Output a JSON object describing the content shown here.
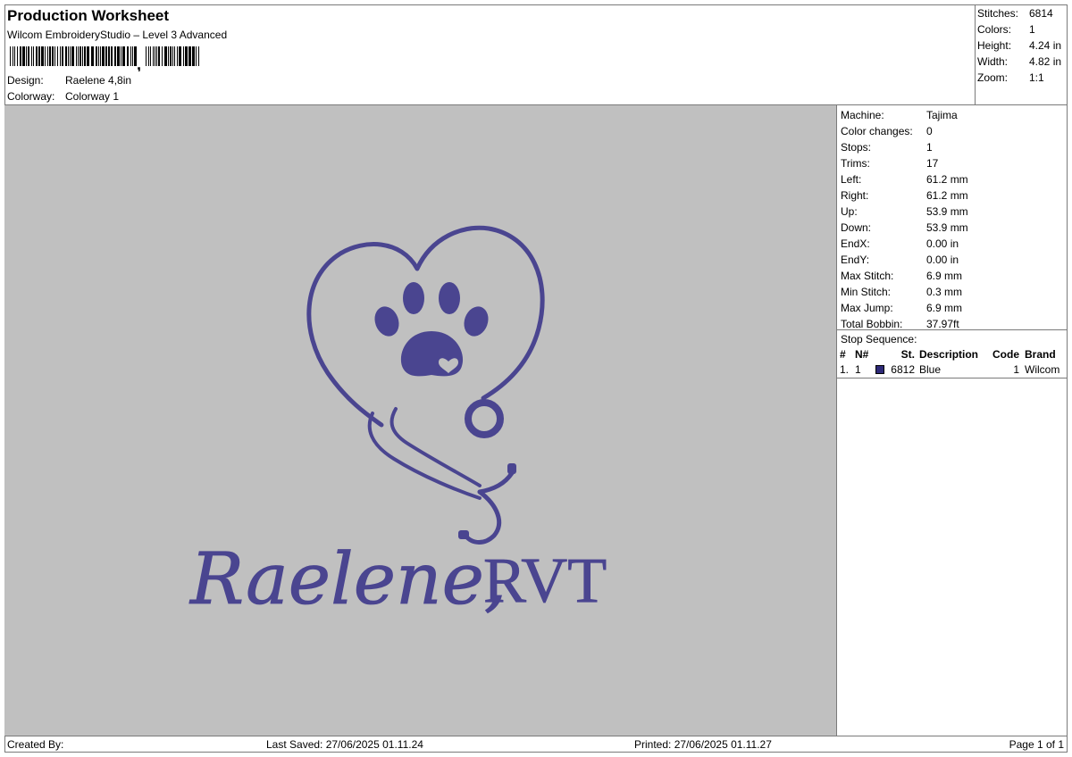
{
  "header": {
    "title": "Production Worksheet",
    "application": "Wilcom EmbroideryStudio – Level 3 Advanced",
    "design_label": "Design:",
    "design_value": "Raelene 4,8in",
    "colorway_label": "Colorway:",
    "colorway_value": "Colorway 1"
  },
  "summary": [
    {
      "label": "Stitches:",
      "value": "6814"
    },
    {
      "label": "Colors:",
      "value": "1"
    },
    {
      "label": "Height:",
      "value": "4.24 in"
    },
    {
      "label": "Width:",
      "value": "4.82 in"
    },
    {
      "label": "Zoom:",
      "value": "1:1"
    }
  ],
  "machine_info": [
    {
      "label": "Machine:",
      "value": "Tajima"
    },
    {
      "label": "Color changes:",
      "value": "0"
    },
    {
      "label": "Stops:",
      "value": "1"
    },
    {
      "label": "Trims:",
      "value": "17"
    },
    {
      "label": "Left:",
      "value": "61.2 mm"
    },
    {
      "label": "Right:",
      "value": "61.2 mm"
    },
    {
      "label": "Up:",
      "value": "53.9 mm"
    },
    {
      "label": "Down:",
      "value": "53.9 mm"
    },
    {
      "label": "EndX:",
      "value": "0.00 in"
    },
    {
      "label": "EndY:",
      "value": "0.00 in"
    },
    {
      "label": "Max Stitch:",
      "value": "6.9 mm"
    },
    {
      "label": "Min Stitch:",
      "value": "0.3 mm"
    },
    {
      "label": "Max Jump:",
      "value": "6.9 mm"
    },
    {
      "label": "Total Bobbin:",
      "value": "37.97ft"
    }
  ],
  "stop_sequence": {
    "title": "Stop Sequence:",
    "headers": {
      "idx": "#",
      "n": "N#",
      "st": "St.",
      "description": "Description",
      "code": "Code",
      "brand": "Brand"
    },
    "rows": [
      {
        "idx": "1.",
        "n": "1",
        "st": "6812",
        "description": "Blue",
        "code": "1",
        "brand": "Wilcom",
        "color": "#2e2a78"
      }
    ]
  },
  "design": {
    "text_script": "Raelene,",
    "text_caps": "RVT",
    "thread_color": "#4a4590",
    "canvas_color": "#c0c0c0"
  },
  "footer": {
    "created_by": "Created By:",
    "last_saved": "Last Saved: 27/06/2025 01.11.24",
    "printed": "Printed: 27/06/2025 01.11.27",
    "page": "Page 1 of 1"
  }
}
